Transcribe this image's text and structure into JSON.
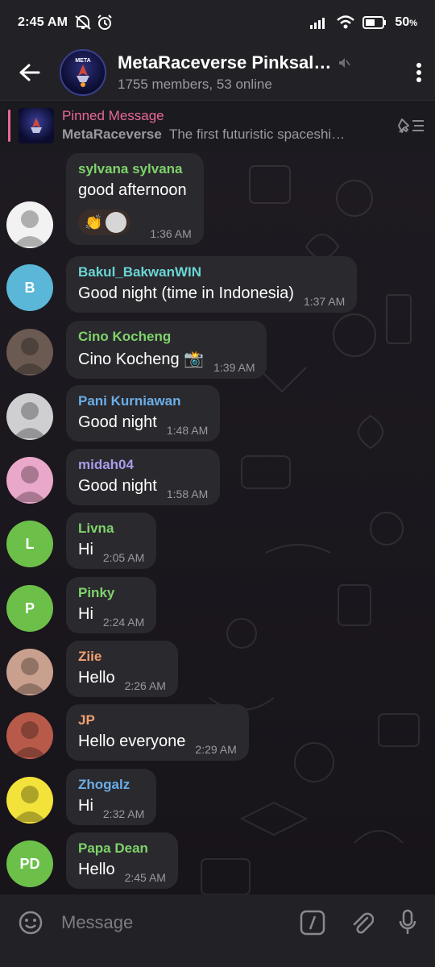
{
  "status_bar": {
    "time": "2:45 AM",
    "battery": "50"
  },
  "header": {
    "title": "MetaRaceverse Pinksal…",
    "subtitle": "1755 members, 53 online",
    "avatar_text": "META RACEVERSE"
  },
  "pinned": {
    "title": "Pinned Message",
    "sender": "MetaRaceverse",
    "text": "The first futuristic spaceshi…"
  },
  "messages": [
    {
      "sender": "sylvana sylvana",
      "sender_color": "#7fd36a",
      "text": "good afternoon",
      "time": "1:36 AM",
      "avatar": {
        "type": "image",
        "bg": "#f2f2f2"
      },
      "reaction": "👏"
    },
    {
      "sender": "Bakul_BakwanWIN",
      "sender_color": "#6ad6d6",
      "text": "Good night (time in Indonesia)",
      "time": "1:37 AM",
      "avatar": {
        "type": "initials",
        "initials": "B",
        "bg": "#5ab7d8"
      }
    },
    {
      "sender": "Cino Kocheng",
      "sender_color": "#7fd36a",
      "text": "Cino Kocheng 📸",
      "time": "1:39 AM",
      "avatar": {
        "type": "image",
        "bg": "#6b5a52"
      }
    },
    {
      "sender": "Pani Kurniawan",
      "sender_color": "#6aaee8",
      "text": "Good night",
      "time": "1:48 AM",
      "avatar": {
        "type": "image",
        "bg": "#cfcfd2"
      }
    },
    {
      "sender": "midah04",
      "sender_color": "#a99be8",
      "text": "Good night",
      "time": "1:58 AM",
      "avatar": {
        "type": "image",
        "bg": "#e9a7c9"
      }
    },
    {
      "sender": "Livna",
      "sender_color": "#7fd36a",
      "text": "Hi",
      "time": "2:05 AM",
      "avatar": {
        "type": "initials",
        "initials": "L",
        "bg": "#6cc04a"
      }
    },
    {
      "sender": "Pinky",
      "sender_color": "#7fd36a",
      "text": "Hi",
      "time": "2:24 AM",
      "avatar": {
        "type": "initials",
        "initials": "P",
        "bg": "#6cc04a"
      }
    },
    {
      "sender": "Ziie",
      "sender_color": "#f0a070",
      "text": "Hello",
      "time": "2:26 AM",
      "avatar": {
        "type": "image",
        "bg": "#c9a08e"
      }
    },
    {
      "sender": "JP",
      "sender_color": "#f0a070",
      "text": "Hello everyone",
      "time": "2:29 AM",
      "avatar": {
        "type": "image",
        "bg": "#b85a4a"
      }
    },
    {
      "sender": "Zhogalz",
      "sender_color": "#6aaee8",
      "text": "Hi",
      "time": "2:32 AM",
      "avatar": {
        "type": "image",
        "bg": "#f2e23a"
      }
    },
    {
      "sender": "Papa Dean",
      "sender_color": "#7fd36a",
      "text": "Hello",
      "time": "2:45 AM",
      "avatar": {
        "type": "initials",
        "initials": "PD",
        "bg": "#6cc04a"
      }
    }
  ],
  "input": {
    "placeholder": "Message"
  },
  "icons": {
    "back": "arrow-left-icon",
    "menu": "dots-vertical-icon",
    "mute": "mute-icon",
    "unpin": "pin-list-icon",
    "emoji": "smile-icon",
    "commands": "slash-icon",
    "attach": "paperclip-icon",
    "mic": "microphone-icon"
  }
}
